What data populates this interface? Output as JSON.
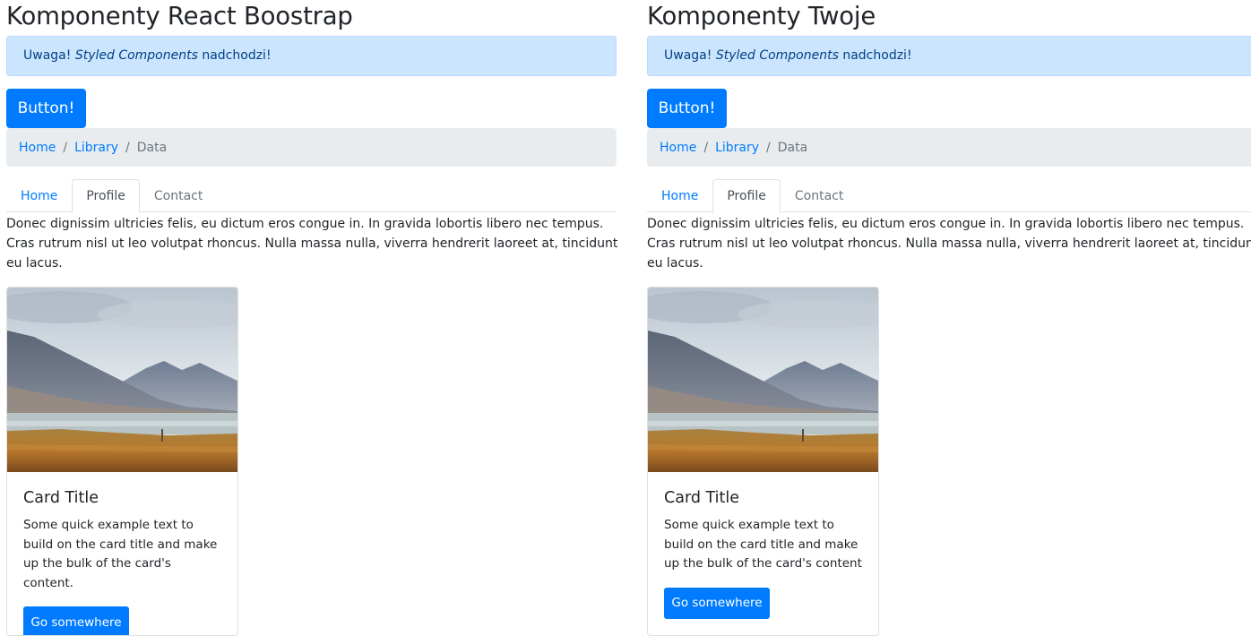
{
  "panels": [
    {
      "title": "Komponenty React Boostrap",
      "alert": {
        "prefix": "Uwaga!",
        "emphasis": "Styled Components",
        "suffix": "nadchodzi!"
      },
      "button_label": "Button!",
      "breadcrumb": {
        "items": [
          "Home",
          "Library"
        ],
        "active": "Data"
      },
      "tabs": [
        "Home",
        "Profile",
        "Contact"
      ],
      "active_tab": "Profile",
      "tab_content": "Donec dignissim ultricies felis, eu dictum eros congue in. In gravida lobortis libero nec tempus. Cras rutrum nisl ut leo volutpat rhoncus. Nulla massa nulla, viverra hendrerit laoreet at, tincidunt eu lacus.",
      "card": {
        "image_icon": "mountain-lake-photo",
        "title": "Card Title",
        "text": "Some quick example text to build on the card title and make up the bulk of the card's content.",
        "button_label": "Go somewhere"
      }
    },
    {
      "title": "Komponenty Twoje",
      "alert": {
        "prefix": "Uwaga!",
        "emphasis": "Styled Components",
        "suffix": "nadchodzi!"
      },
      "button_label": "Button!",
      "breadcrumb": {
        "items": [
          "Home",
          "Library"
        ],
        "active": "Data"
      },
      "tabs": [
        "Home",
        "Profile",
        "Contact"
      ],
      "active_tab": "Profile",
      "tab_content": "Donec dignissim ultricies felis, eu dictum eros congue in. In gravida lobortis libero nec tempus. Cras rutrum nisl ut leo volutpat rhoncus. Nulla massa nulla, viverra hendrerit laoreet at, tincidunt eu lacus.",
      "card": {
        "image_icon": "mountain-lake-photo",
        "title": "Card Title",
        "text": "Some quick example text to build on the card title and make up the bulk of the card's content",
        "button_label": "Go somewhere"
      }
    }
  ],
  "colors": {
    "primary": "#007bff",
    "alert_bg": "#cce5ff",
    "breadcrumb_bg": "#e9ecef",
    "text": "#212529"
  }
}
